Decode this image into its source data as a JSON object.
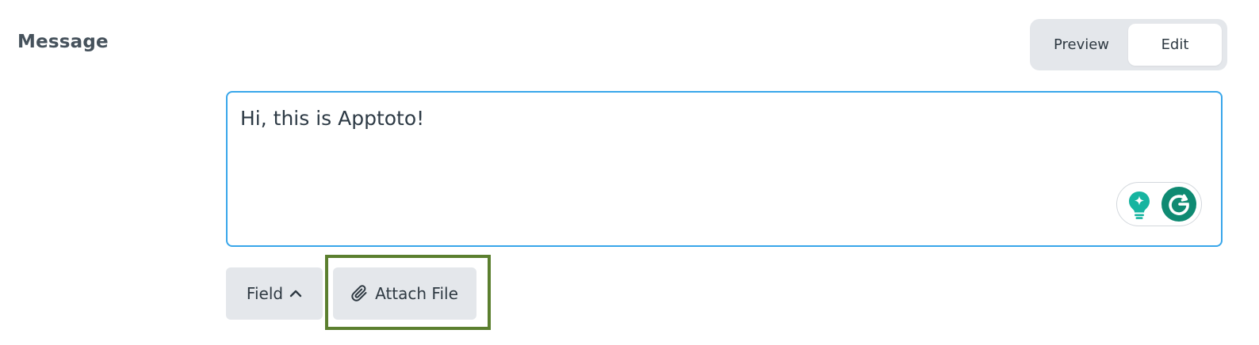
{
  "section": {
    "label": "Message"
  },
  "mode_toggle": {
    "preview_label": "Preview",
    "edit_label": "Edit",
    "active": "Edit"
  },
  "editor": {
    "text": "Hi, this is Apptoto!",
    "assist_icons": [
      "lightbulb-sparkle-icon",
      "grammarly-g-icon"
    ]
  },
  "toolbar": {
    "field_label": "Field",
    "field_icon": "chevron-up-icon",
    "attach_label": "Attach File",
    "attach_icon": "paperclip-icon"
  },
  "colors": {
    "editor_border": "#38a6ea",
    "button_bg": "#e4e7eb",
    "highlight": "#5b7f2f",
    "assist_green": "#17b4a0",
    "grammarly_green": "#0f8a72"
  }
}
